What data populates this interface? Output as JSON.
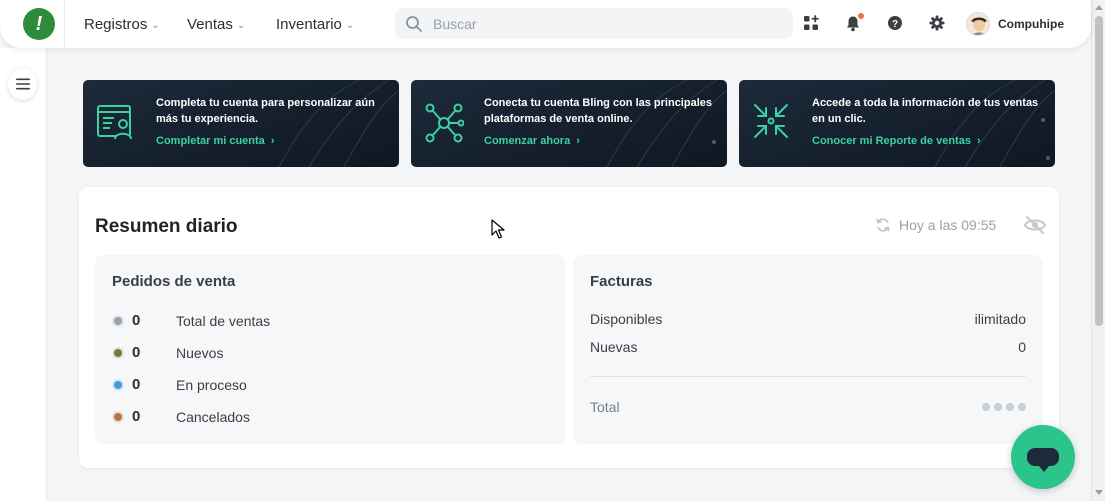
{
  "header": {
    "logo_icon": "bling-logo-icon",
    "logo_char": "!",
    "nav": [
      {
        "label": "Registros"
      },
      {
        "label": "Ventas"
      },
      {
        "label": "Inventario"
      }
    ],
    "search": {
      "placeholder": "Buscar",
      "value": ""
    },
    "icons": [
      "apps-grid-icon",
      "bell-icon",
      "help-icon",
      "gear-icon"
    ],
    "notification_dot_color": "#e8743a",
    "user": {
      "name": "Compuhipe"
    }
  },
  "banners": [
    {
      "text": "Completa tu cuenta para personalizar aún más tu experiencia.",
      "link": "Completar mi cuenta",
      "icon": "profile-card-icon"
    },
    {
      "text": "Conecta tu cuenta Bling con las principales plataformas de venta online.",
      "link": "Comenzar ahora",
      "icon": "network-hub-icon"
    },
    {
      "text": "Accede a toda la información de tus ventas en un clic.",
      "link": "Conocer mi Reporte de ventas",
      "icon": "collapse-arrows-icon"
    }
  ],
  "summary": {
    "title": "Resumen diario",
    "updated": "Hoy a las 09:55",
    "orders": {
      "title": "Pedidos de venta",
      "rows": [
        {
          "value": "0",
          "label": "Total de ventas",
          "color": "#9aa0a6"
        },
        {
          "value": "0",
          "label": "Nuevos",
          "color": "#7a7a2e"
        },
        {
          "value": "0",
          "label": "En proceso",
          "color": "#3aa0e0"
        },
        {
          "value": "0",
          "label": "Cancelados",
          "color": "#c0703a"
        }
      ]
    },
    "invoices": {
      "title": "Facturas",
      "rows": [
        {
          "label": "Disponibles",
          "value": "ilimitado"
        },
        {
          "label": "Nuevas",
          "value": "0"
        }
      ],
      "total_label": "Total"
    }
  },
  "colors": {
    "brand_green": "#2e8b3a",
    "accent_teal": "#3ad2a0",
    "chat_button": "#2bc48a",
    "banner_bg": "#152030"
  }
}
